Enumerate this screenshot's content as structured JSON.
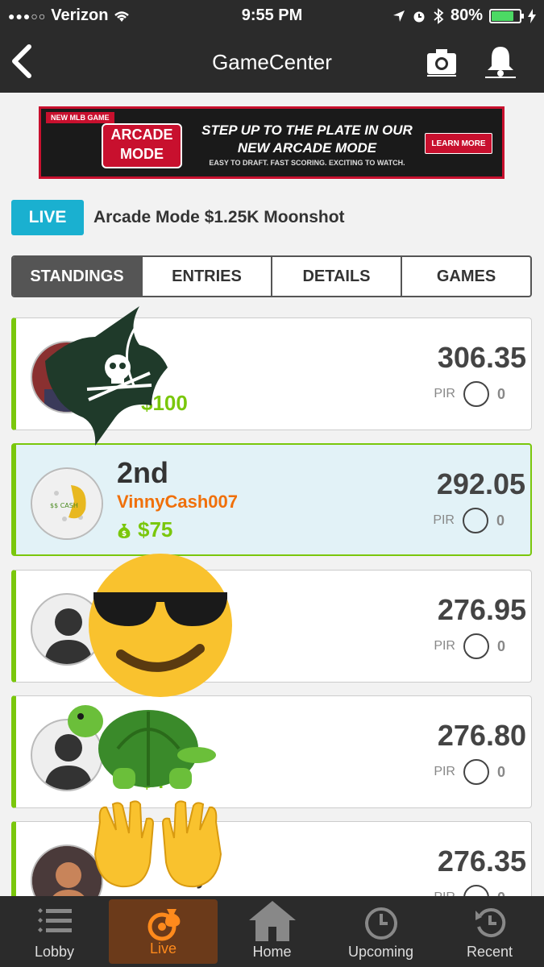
{
  "status_bar": {
    "carrier": "Verizon",
    "time": "9:55 PM",
    "battery": "80%",
    "battery_level": 0.8
  },
  "nav": {
    "title": "GameCenter"
  },
  "banner": {
    "tag": "NEW MLB GAME",
    "logo_text": "ARCADE MODE",
    "headline": "STEP UP TO THE PLATE IN OUR NEW ARCADE MODE",
    "sub": "EASY TO DRAFT. FAST SCORING. EXCITING TO WATCH.",
    "cta": "LEARN MORE"
  },
  "contest": {
    "badge": "LIVE",
    "title": "Arcade Mode $1.25K Moonshot"
  },
  "tabs": [
    {
      "label": "STANDINGS",
      "active": true
    },
    {
      "label": "ENTRIES",
      "active": false
    },
    {
      "label": "DETAILS",
      "active": false
    },
    {
      "label": "GAMES",
      "active": false
    }
  ],
  "standings": [
    {
      "rank": "",
      "user": "",
      "prize": "$100",
      "score": "306.35",
      "pir_label": "PIR",
      "pir": "0"
    },
    {
      "rank": "2nd",
      "user": "VinnyCash007",
      "prize": "$75",
      "score": "292.05",
      "pir_label": "PIR",
      "pir": "0"
    },
    {
      "rank": "",
      "user": "",
      "prize": "",
      "score": "276.95",
      "pir_label": "PIR",
      "pir": "0"
    },
    {
      "rank": "",
      "user": "",
      "prize": "$4",
      "score": "276.80",
      "pir_label": "PIR",
      "pir": "0"
    },
    {
      "rank": "",
      "user": "dy",
      "prize": "",
      "score": "276.35",
      "pir_label": "PIR",
      "pir": "0"
    }
  ],
  "tabbar": [
    {
      "label": "Lobby",
      "icon": "list-icon"
    },
    {
      "label": "Live",
      "icon": "money-bag-icon",
      "active": true
    },
    {
      "label": "Home",
      "icon": "home-icon"
    },
    {
      "label": "Upcoming",
      "icon": "clock-icon"
    },
    {
      "label": "Recent",
      "icon": "history-icon"
    }
  ],
  "colors": {
    "accent_green": "#7ac70c",
    "username_orange": "#f0700a",
    "live_blue": "#1ab0d0",
    "active_tab": "#555555"
  }
}
